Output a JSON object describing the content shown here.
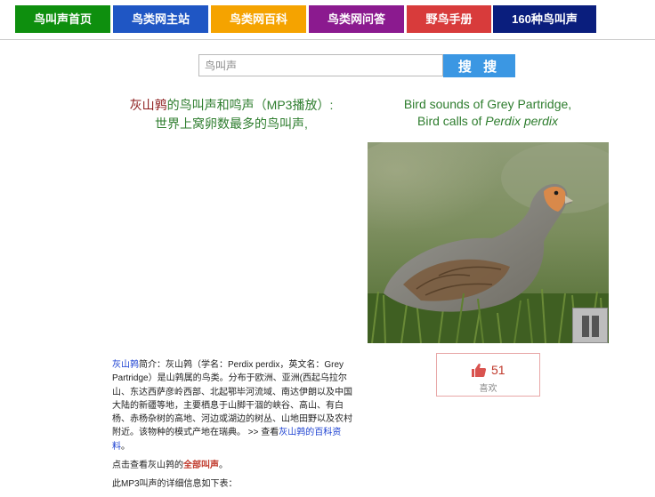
{
  "nav": {
    "items": [
      {
        "label": "鸟叫声首页",
        "color": "#0e8f0e"
      },
      {
        "label": "鸟类网主站",
        "color": "#1f56c4"
      },
      {
        "label": "鸟类网百科",
        "color": "#f5a300"
      },
      {
        "label": "鸟类网问答",
        "color": "#8b1a8f"
      },
      {
        "label": "野鸟手册",
        "color": "#d83b3b"
      },
      {
        "label": "160种鸟叫声",
        "color": "#0a1e7d"
      }
    ]
  },
  "search": {
    "placeholder": "鸟叫声",
    "button_label": "搜 搜"
  },
  "title_cn": {
    "bird": "灰山鹑",
    "line1_rest": "的鸟叫声和鸣声（MP3播放）:",
    "line2": "世界上窝卵数最多的鸟叫声,"
  },
  "title_en": {
    "line1": "Bird sounds of Grey Partridge,",
    "line2_prefix": "Bird calls of ",
    "line2_latin": "Perdix perdix"
  },
  "player": {
    "pause_icon": "pause-icon"
  },
  "like": {
    "count": "51",
    "label": "喜欢",
    "icon": "thumbs-up-icon"
  },
  "info": {
    "bird_link": "灰山鹑",
    "intro": "简介：灰山鹑（学名：Perdix perdix，英文名：Grey Partridge）是山鹑属的鸟类。分布于欧洲、亚洲(西起乌拉尔山、东达西萨彦岭西部、北起鄂毕河流域、南达伊朗以及中国大陆的新疆等地，主要栖息于山脚干涸的峡谷、高山、有白杨、赤杨杂树的高地、河边或湖边的树丛、山地田野以及农村附近。该物种的模式产地在瑞典。 >> 查看",
    "encyclopedia_link": "灰山鹑的百科资料",
    "period": "。",
    "all_calls_prefix": "点击查看灰山鹑的",
    "all_calls_link": "全部叫声",
    "all_calls_suffix": "。",
    "next_line": "此MP3叫声的详细信息如下表："
  }
}
